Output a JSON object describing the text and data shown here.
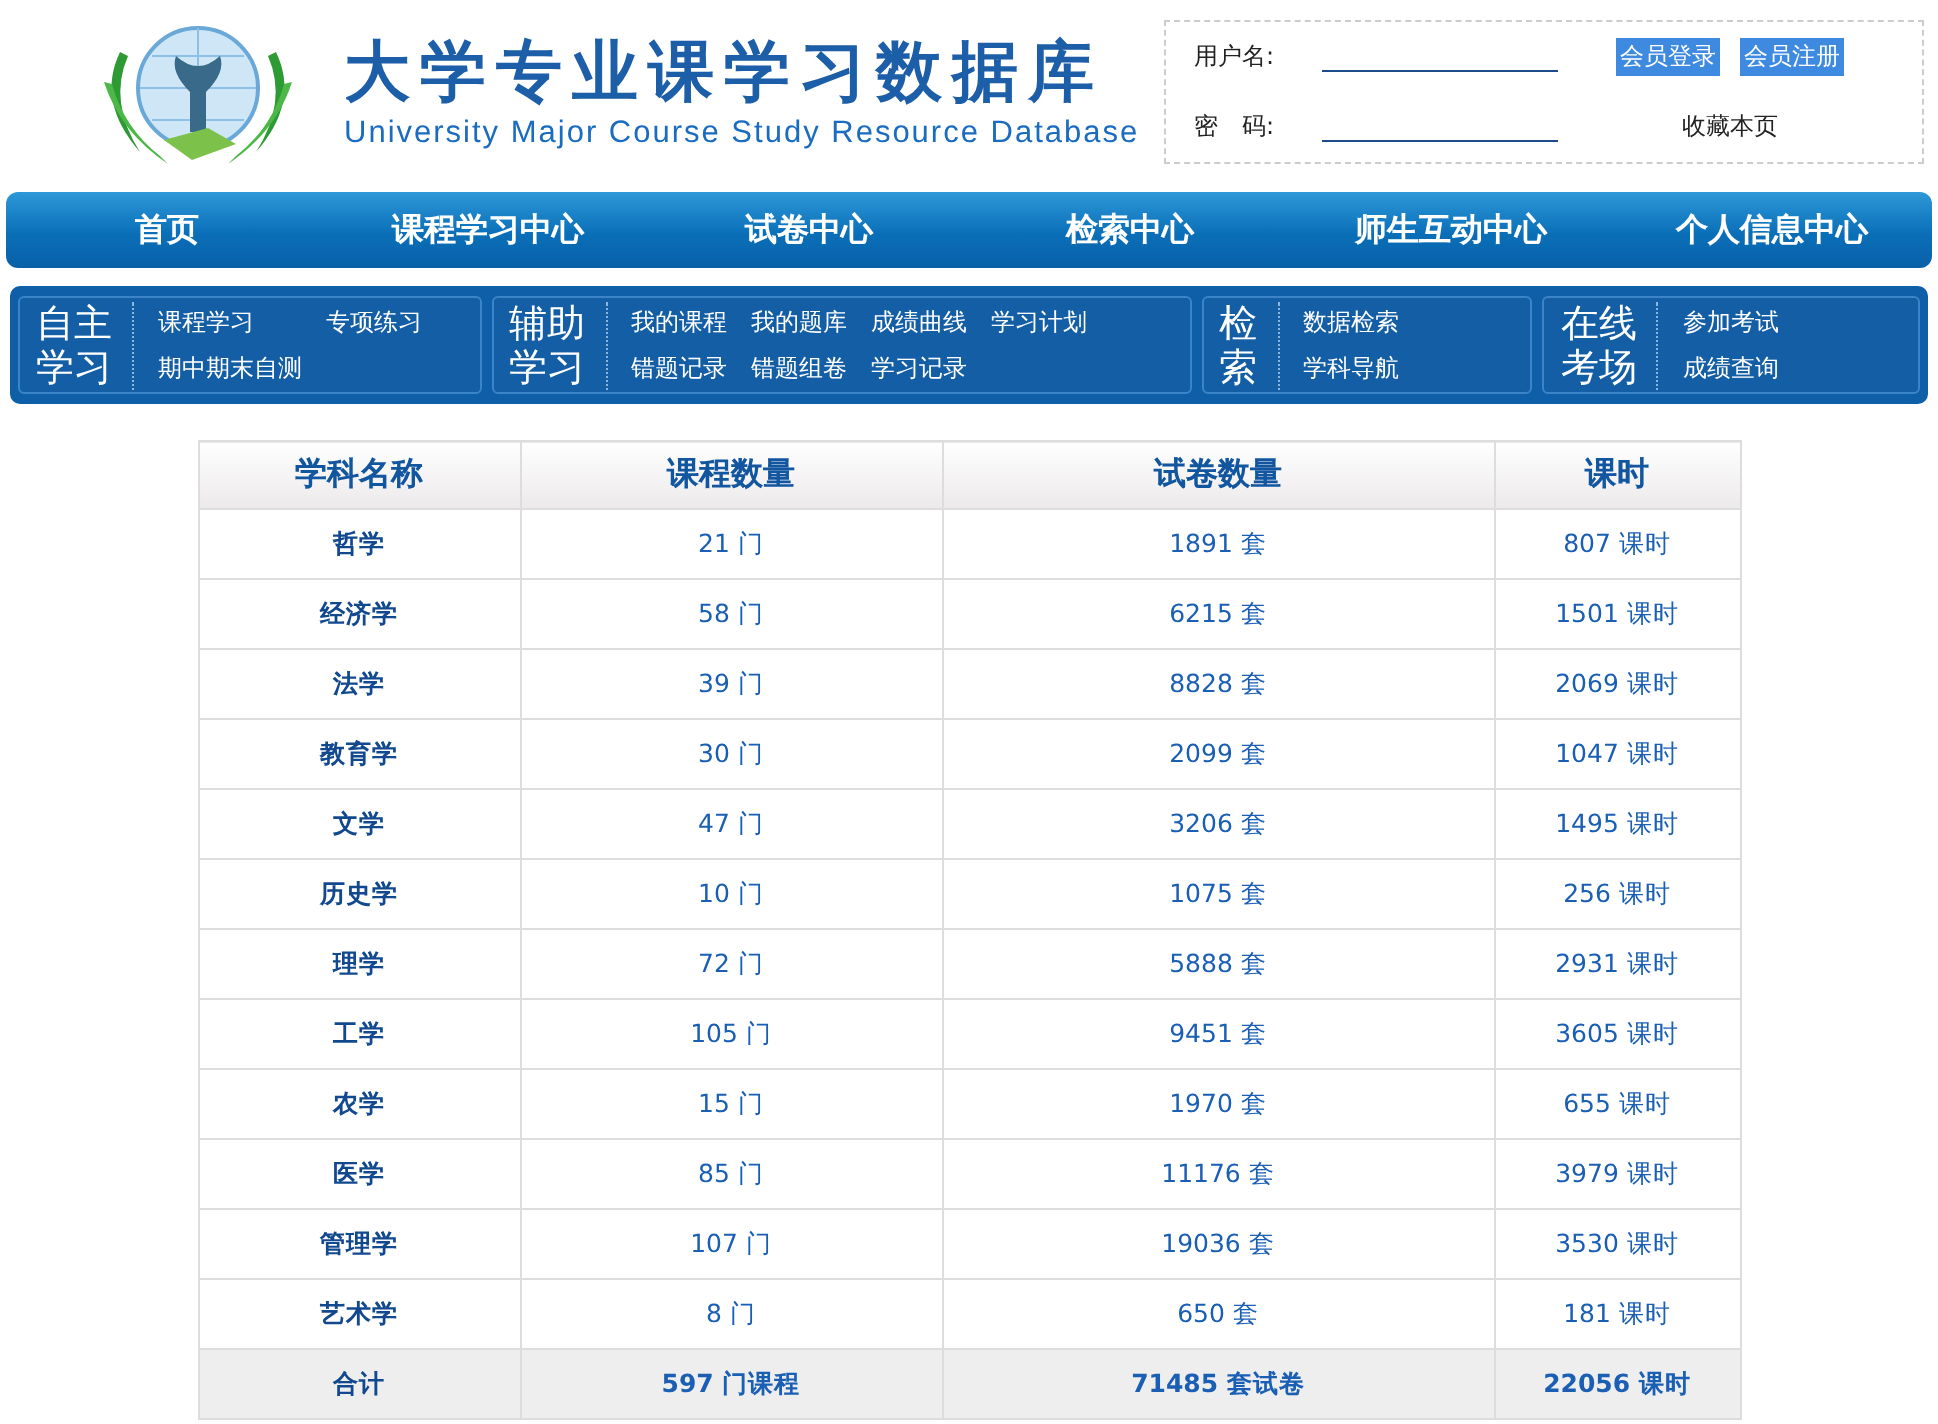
{
  "header": {
    "title": "大学专业课学习数据库",
    "subtitle": "University Major Course Study Resource Database"
  },
  "login": {
    "username_label": "用户名:",
    "password_label": "密　码:",
    "buttons": [
      "会员登录",
      "会员注册"
    ],
    "bookmark": "收藏本页"
  },
  "nav": [
    "首页",
    "课程学习中心",
    "试卷中心",
    "检索中心",
    "师生互动中心",
    "个人信息中心"
  ],
  "subnav": [
    {
      "title_lines": [
        "自主",
        "学习"
      ],
      "links": [
        "课程学习",
        "专项练习",
        "期中期末自测"
      ]
    },
    {
      "title_lines": [
        "辅助",
        "学习"
      ],
      "links": [
        "我的课程",
        "我的题库",
        "成绩曲线",
        "学习计划",
        "错题记录",
        "错题组卷",
        "学习记录"
      ]
    },
    {
      "title_lines": [
        "检",
        "索"
      ],
      "links": [
        "数据检索",
        "学科导航"
      ]
    },
    {
      "title_lines": [
        "在线",
        "考场"
      ],
      "links": [
        "参加考试",
        "成绩查询"
      ]
    }
  ],
  "table": {
    "columns": [
      "学科名称",
      "课程数量",
      "试卷数量",
      "课时"
    ],
    "rows": [
      [
        "哲学",
        "21 门",
        "1891 套",
        "807 课时"
      ],
      [
        "经济学",
        "58 门",
        "6215 套",
        "1501 课时"
      ],
      [
        "法学",
        "39 门",
        "8828 套",
        "2069 课时"
      ],
      [
        "教育学",
        "30 门",
        "2099 套",
        "1047 课时"
      ],
      [
        "文学",
        "47 门",
        "3206 套",
        "1495 课时"
      ],
      [
        "历史学",
        "10 门",
        "1075 套",
        "256 课时"
      ],
      [
        "理学",
        "72 门",
        "5888 套",
        "2931 课时"
      ],
      [
        "工学",
        "105 门",
        "9451 套",
        "3605 课时"
      ],
      [
        "农学",
        "15 门",
        "1970 套",
        "655 课时"
      ],
      [
        "医学",
        "85 门",
        "11176 套",
        "3979 课时"
      ],
      [
        "管理学",
        "107 门",
        "19036 套",
        "3530 课时"
      ],
      [
        "艺术学",
        "8 门",
        "650 套",
        "181 课时"
      ]
    ],
    "total": [
      "合计",
      "597 门课程",
      "71485 套试卷",
      "22056 课时"
    ]
  }
}
